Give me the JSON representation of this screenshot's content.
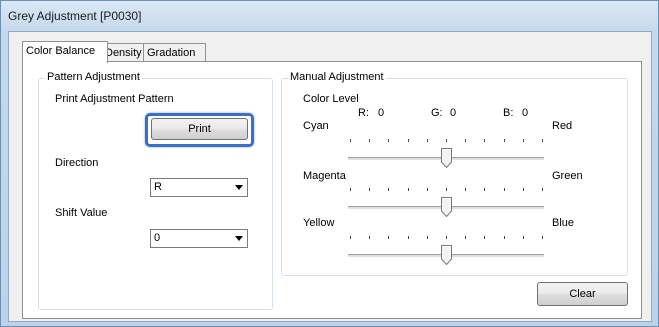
{
  "window": {
    "title": "Grey Adjustment [P0030]"
  },
  "tabs": [
    {
      "label": "Color Balance",
      "active": true
    },
    {
      "label": "Density",
      "active": false
    },
    {
      "label": "Gradation",
      "active": false
    }
  ],
  "pattern_adjustment": {
    "group_title": "Pattern Adjustment",
    "print_pattern_label": "Print Adjustment Pattern",
    "print_button": "Print",
    "direction_label": "Direction",
    "direction_value": "R",
    "shift_label": "Shift Value",
    "shift_value": "0"
  },
  "manual_adjustment": {
    "group_title": "Manual Adjustment",
    "color_level_label": "Color Level",
    "levels": {
      "r_label": "R:",
      "r_value": "0",
      "g_label": "G:",
      "g_value": "0",
      "b_label": "B:",
      "b_value": "0"
    },
    "sliders": [
      {
        "left": "Cyan",
        "right": "Red",
        "value": 0,
        "min": -5,
        "max": 5
      },
      {
        "left": "Magenta",
        "right": "Green",
        "value": 0,
        "min": -5,
        "max": 5
      },
      {
        "left": "Yellow",
        "right": "Blue",
        "value": 0,
        "min": -5,
        "max": 5
      }
    ]
  },
  "clear_button": "Clear",
  "colors": {
    "focus": "#3a70bf",
    "window_frame": "#bcd2e8"
  },
  "icons": {
    "combo_arrow": "chevron-down-icon"
  }
}
